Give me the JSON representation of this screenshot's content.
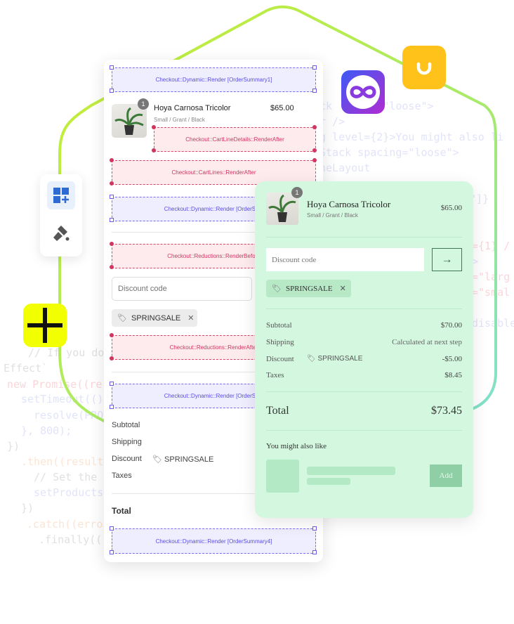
{
  "colors": {
    "path_start": "#c8ee2e",
    "path_end": "#7fe0d2",
    "zone_purple": "#7a6cf0",
    "zone_pink": "#d8456b",
    "green_card": "#d4f7df",
    "add_button": "#8fcfa5",
    "yellow_icon": "#f2ff00",
    "orange_icon": "#ffc21a"
  },
  "code_lines": [
    {
      "text": "ck      g=\"loose\">",
      "tone": "blue"
    },
    {
      "text": "r />",
      "tone": "blue"
    },
    {
      "text": "g level={2}>You might also li",
      "tone": "blue"
    },
    {
      "text": "Stack spacing=\"loose\">",
      "tone": "blue"
    },
    {
      "text": "neLayout",
      "tone": "blue"
    },
    {
      "text": "o\"]}",
      "tone": "blue"
    },
    {
      "text": "={1} /",
      "tone": "red"
    },
    {
      "text": ">",
      "tone": "blue"
    },
    {
      "text": "=\"larg",
      "tone": "red"
    },
    {
      "text": "=\"smal",
      "tone": "red"
    },
    {
      "text": "disable",
      "tone": "blue"
    },
    {
      "text": "// If you don't",
      "tone": "gray"
    },
    {
      "text": "Effect`",
      "tone": "gray"
    },
    {
      "text": "new Promise((re",
      "tone": "red"
    },
    {
      "text": "setTimeout(()",
      "tone": "blue"
    },
    {
      "text": "resolve(PRO",
      "tone": "blue"
    },
    {
      "text": "}, 800);",
      "tone": "blue"
    },
    {
      "text": "})",
      "tone": "gray"
    },
    {
      "text": ".then((result",
      "tone": "orange"
    },
    {
      "text": "// Set the",
      "tone": "gray"
    },
    {
      "text": "setProducts",
      "tone": "blue"
    },
    {
      "text": "})",
      "tone": "gray"
    },
    {
      "text": ".catch((error",
      "tone": "orange"
    },
    {
      "text": ".finally(() =",
      "tone": "gray"
    }
  ],
  "icons": {
    "toolbar": [
      "add-block-icon",
      "paint-brush-icon"
    ],
    "apps": [
      "crosshair-app-icon",
      "infinity-app-icon",
      "smile-app-icon"
    ]
  },
  "editor": {
    "zones": {
      "order_summary_1": "Checkout::Dynamic::Render [OrderSummary1]",
      "cart_line_details": "Checkout::CartLineDetails::RenderAfter",
      "cart_lines": "Checkout::CartLines::RenderAfter",
      "order_summary_2": "Checkout::Dynamic::Render [OrderSum",
      "reductions_before": "Checkout::Reductions::RenderBefore",
      "reductions_after": "Checkout::Reductions::RenderAfter",
      "order_summary_3": "Checkout::Dynamic::Render [OrderSum",
      "order_summary_4": "Checkout::Dynamic::Render [OrderSummary4]"
    },
    "product": {
      "quantity": "1",
      "name": "Hoya Carnosa Tricolor",
      "variant": "Small / Grant / Black",
      "price": "$65.00"
    },
    "discount_placeholder": "Discount code",
    "applied_code": "SPRINGSALE",
    "summary": {
      "subtotal": "Subtotal",
      "shipping": "Shipping",
      "discount": "Discount",
      "discount_code": "SPRINGSALE",
      "taxes": "Taxes",
      "total": "Total"
    }
  },
  "preview": {
    "product": {
      "quantity": "1",
      "name": "Hoya Carnosa Tricolor",
      "variant": "Small / Grant / Black",
      "price": "$65.00"
    },
    "discount_placeholder": "Discount code",
    "applied_code": "SPRINGSALE",
    "summary": {
      "subtotal_label": "Subtotal",
      "subtotal": "$70.00",
      "shipping_label": "Shipping",
      "shipping": "Calculated at next step",
      "discount_label": "Discount",
      "discount_code": "SPRINGSALE",
      "discount": "-$5.00",
      "taxes_label": "Taxes",
      "taxes": "$8.45",
      "total_label": "Total",
      "total": "$73.45"
    },
    "upsell": {
      "heading": "You might also like",
      "add_label": "Add"
    }
  }
}
